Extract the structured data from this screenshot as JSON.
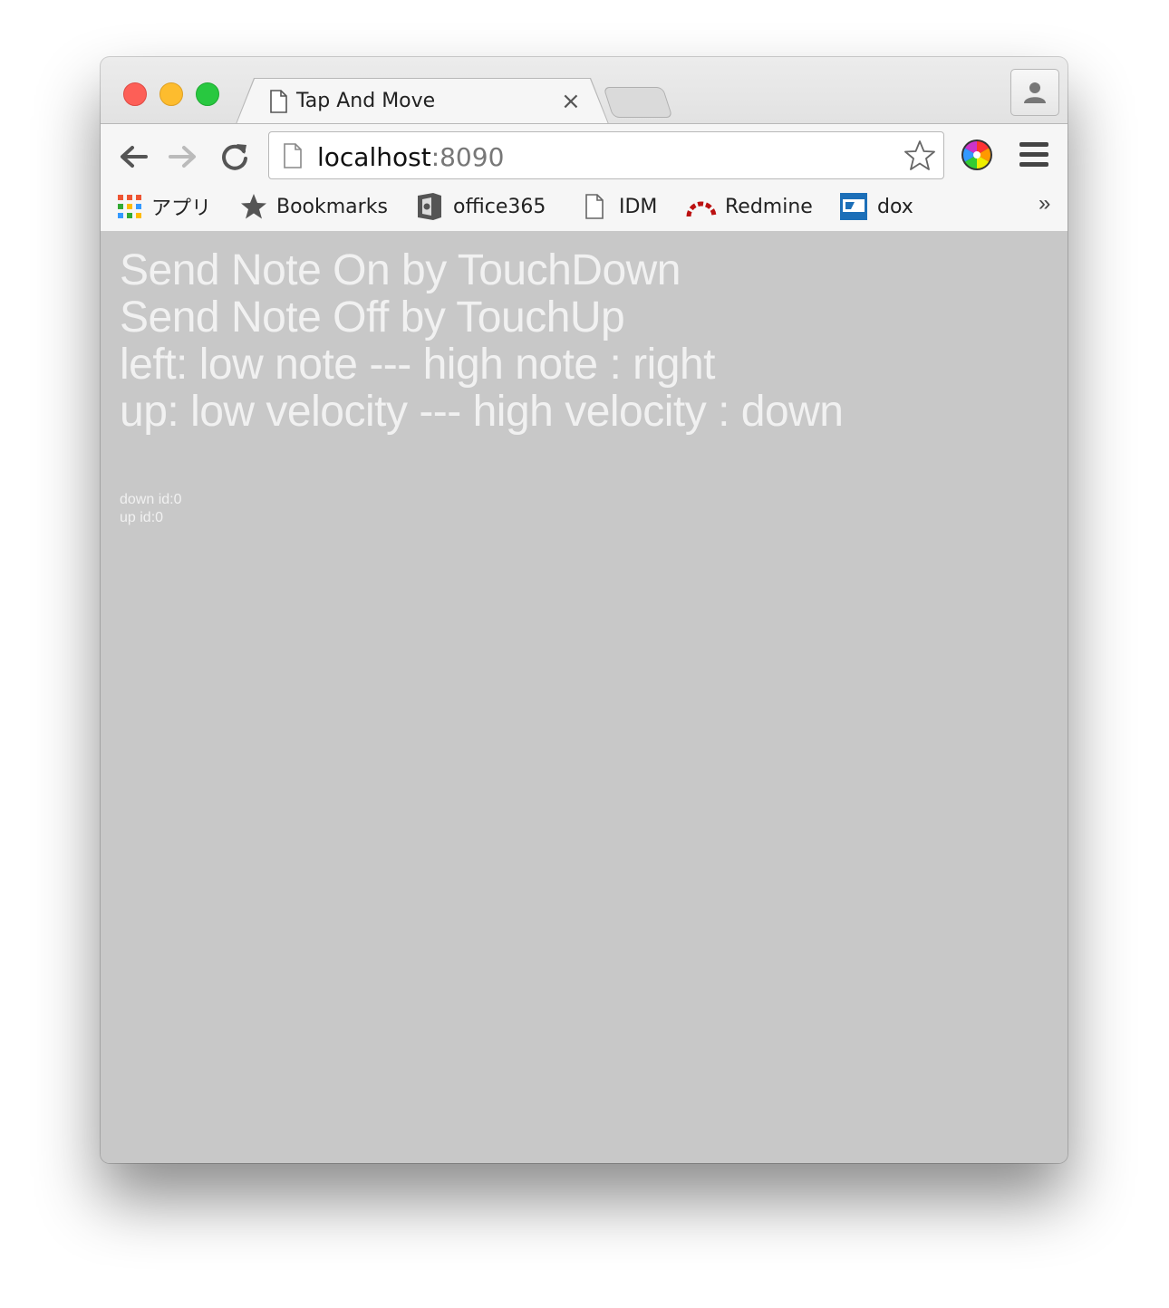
{
  "browser": {
    "tab": {
      "title": "Tap And Move",
      "close_label": "×"
    },
    "address": {
      "host": "localhost",
      "port": ":8090"
    },
    "bookmarks": [
      {
        "label": "アプリ",
        "icon": "apps-grid-icon"
      },
      {
        "label": "Bookmarks",
        "icon": "star-icon"
      },
      {
        "label": "office365",
        "icon": "office-icon"
      },
      {
        "label": "IDM",
        "icon": "document-icon"
      },
      {
        "label": "Redmine",
        "icon": "redmine-icon"
      },
      {
        "label": "dox",
        "icon": "dox-icon"
      }
    ],
    "bookmarks_more": "»"
  },
  "page": {
    "lines": [
      "Send Note On by TouchDown",
      "Send Note Off by TouchUp",
      "left: low note --- high note : right",
      "up: low velocity --- high velocity : down"
    ],
    "status": {
      "down": "down id:0",
      "up": "up id:0"
    }
  },
  "colors": {
    "page_background": "#c8c8c8",
    "page_text": "#f1f1f1",
    "close_light": "#fd5f57",
    "minimize_light": "#fdbc2e",
    "maximize_light": "#28c840"
  }
}
